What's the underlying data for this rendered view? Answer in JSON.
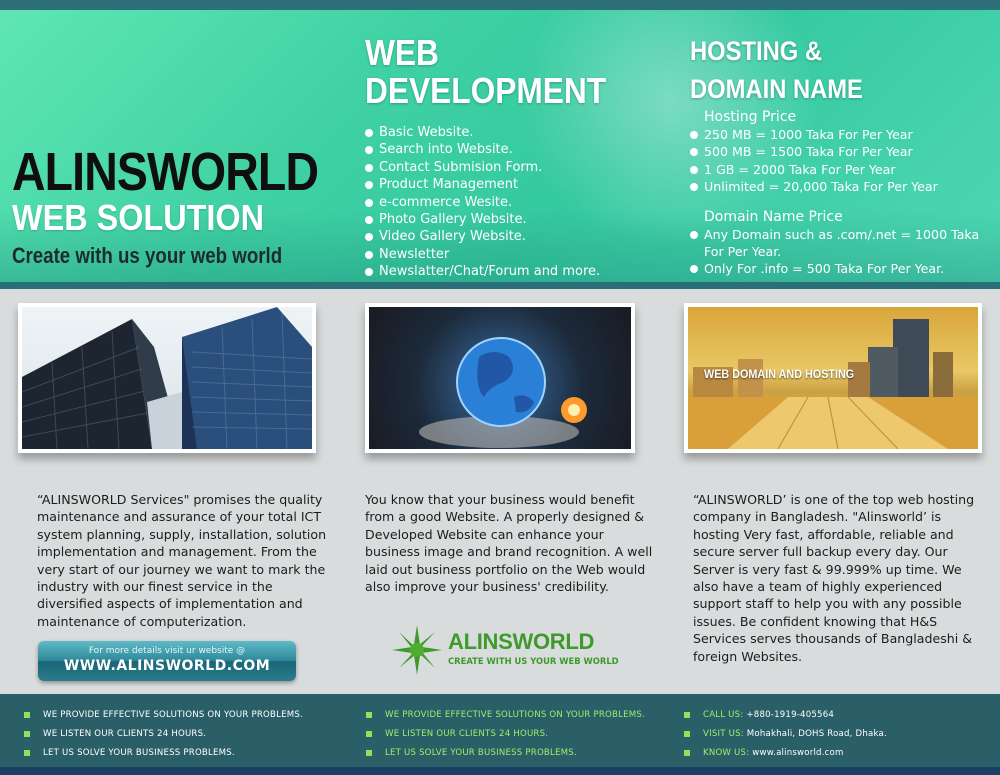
{
  "brand": {
    "name": "ALINSWORLD",
    "subtitle": "WEB SOLUTION",
    "tagline": "Create with us your web world"
  },
  "web_development": {
    "title_line1": "WEB",
    "title_line2": "DEVELOPMENT",
    "items": [
      "Basic Website.",
      "Search into Website.",
      "Contact Submision Form.",
      "Product Management",
      "e-commerce Wesite.",
      "Photo Gallery Website.",
      "Video Gallery Website.",
      "Newsletter",
      "Newslatter/Chat/Forum and more."
    ]
  },
  "hosting": {
    "title_line1": "HOSTING &",
    "title_line2": "DOMAIN NAME",
    "hosting_price_heading": "Hosting Price",
    "hosting_items": [
      "250 MB = 1000 Taka For Per Year",
      "500 MB = 1500 Taka For Per Year",
      "1 GB = 2000 Taka For Per Year",
      "Unlimited = 20,000 Taka For Per Year"
    ],
    "domain_price_heading": "Domain Name Price",
    "domain_items": [
      "Any Domain such as .com/.net = 1000 Taka For Per Year.",
      "Only For .info = 500 Taka For Per Year."
    ]
  },
  "images": {
    "web_domain_caption": "WEB DOMAIN AND HOSTING"
  },
  "columns": {
    "services_text": "“ALINSWORLD Services\" promises the quality maintenance and assurance of your total ICT system planning, supply, installation, solution implementation and management. From the very start of our journey we want to mark the industry with our finest service in the diversified aspects of implementation and maintenance of computerization.",
    "website_text": "You know that your business would benefit from a good Website. A properly designed & Developed Website can enhance your business image and brand recognition. A well laid out business portfolio on the Web would also improve your business' credibility.",
    "hosting_text": "“ALINSWORLD’ is one of the top web hosting company in Bangladesh. \"Alinsworld’ is hosting Very fast, affordable, reliable and secure server full backup every day. Our Server is very fast & 99.999% up time. We also have a team of highly experienced support staff to help you with any possible issues. Be confident knowing that H&S Services serves thousands of Bangladeshi & foreign Websites."
  },
  "visit_button": {
    "small": "For more details visit ur website @",
    "big": "WWW.ALINSWORLD.COM"
  },
  "logo": {
    "name": "ALINSWORLD",
    "tagline": "CREATE WITH US YOUR WEB WORLD"
  },
  "footer": {
    "col1": [
      "WE PROVIDE EFFECTIVE SOLUTIONS ON YOUR PROBLEMS.",
      "WE LISTEN OUR CLIENTS 24 HOURS.",
      "LET US SOLVE YOUR BUSINESS PROBLEMS."
    ],
    "col2": [
      "WE PROVIDE EFFECTIVE SOLUTIONS ON YOUR PROBLEMS.",
      "WE LISTEN OUR CLIENTS 24 HOURS.",
      "LET US SOLVE YOUR BUSINESS PROBLEMS."
    ],
    "contact": {
      "call_key": "CALL US:",
      "call_val": "+880-1919-405564",
      "visit_key": "VISIT US:",
      "visit_val": "Mohakhali, DOHS Road, Dhaka.",
      "know_key": "KNOW US:",
      "know_val": "www.alinsworld.com"
    }
  },
  "colors": {
    "header_green": "#3fd1a3",
    "footer_teal": "#2a5f68",
    "accent_green": "#3e9a2a",
    "bullet_green": "#8fe35a"
  }
}
